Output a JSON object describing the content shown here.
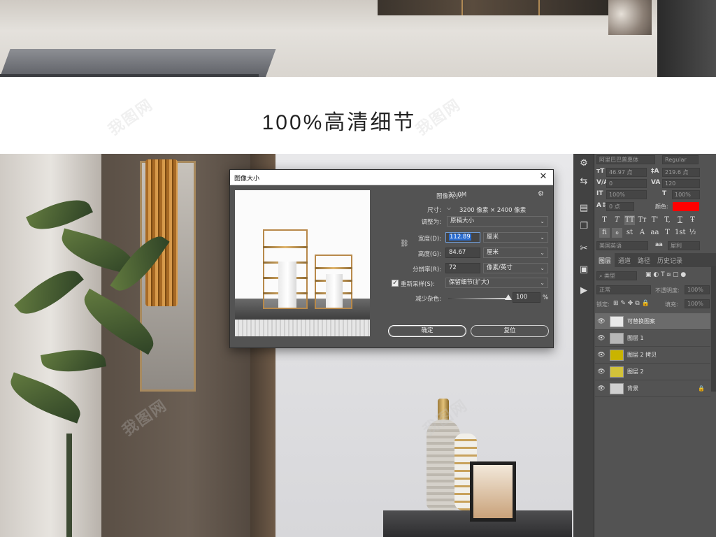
{
  "heading": "100%高清细节",
  "watermark": "我图网",
  "dialog": {
    "title": "图像大小",
    "image_size_label": "图像大小:",
    "image_size_value": "22.0M",
    "dimensions_label": "尺寸:",
    "dimensions_value": "3200 像素 × 2400 像素",
    "fit_to_label": "调整为:",
    "fit_to_value": "原稿大小",
    "width_label": "宽度(D):",
    "width_value": "112.89",
    "width_unit": "厘米",
    "height_label": "高度(G):",
    "height_value": "84.67",
    "height_unit": "厘米",
    "resolution_label": "分辨率(R):",
    "resolution_value": "72",
    "resolution_unit": "像素/英寸",
    "resample_label": "重新采样(S):",
    "resample_value": "保留细节(扩大)",
    "noise_label": "减少杂色:",
    "noise_value": "100",
    "noise_unit": "%",
    "noise_level": 1.0,
    "ok_label": "确定",
    "reset_label": "复位"
  },
  "character_panel": {
    "font_family": "阿里巴巴普惠体",
    "font_style": "Regular",
    "size": "46.97 点",
    "leading": "219.6 点",
    "kerning": "0",
    "tracking": "120",
    "vertical_scale": "100%",
    "horizontal_scale": "100%",
    "baseline_shift": "0 点",
    "color_label": "颜色:",
    "color_hex": "#ff0000",
    "language": "美国英语",
    "antialias": "犀利",
    "antialias_icon": "aa",
    "style_buttons": [
      "T",
      "T",
      "TT",
      "Tт",
      "T'",
      "T,",
      "T",
      "Ŧ"
    ],
    "opentype_buttons": [
      "fi",
      "ℴ",
      "st",
      "A",
      "aa",
      "T",
      "1st",
      "½"
    ]
  },
  "layers_panel": {
    "tabs": [
      "图层",
      "通道",
      "路径",
      "历史记录"
    ],
    "filter_placeholder": "类型",
    "blend_mode": "正常",
    "opacity_label": "不透明度:",
    "opacity_value": "100%",
    "lock_label": "锁定:",
    "fill_label": "填充:",
    "fill_value": "100%",
    "layers": [
      {
        "name": "可替换图案",
        "thumb": "#e9e9e9",
        "selected": true
      },
      {
        "name": "图层 1",
        "thumb": "#b7b7b7",
        "selected": false
      },
      {
        "name": "图层 2 拷贝",
        "thumb": "#c9b400",
        "selected": false
      },
      {
        "name": "图层 2",
        "thumb": "#d2c23a",
        "selected": false
      },
      {
        "name": "背景",
        "thumb": "#cfcfcf",
        "selected": false
      }
    ]
  },
  "toolbar": {
    "tools": [
      "settings-sliders-icon",
      "arrange-icon",
      "document-icon",
      "copy-icon",
      "scissors-icon",
      "square-icon",
      "play-icon"
    ]
  }
}
